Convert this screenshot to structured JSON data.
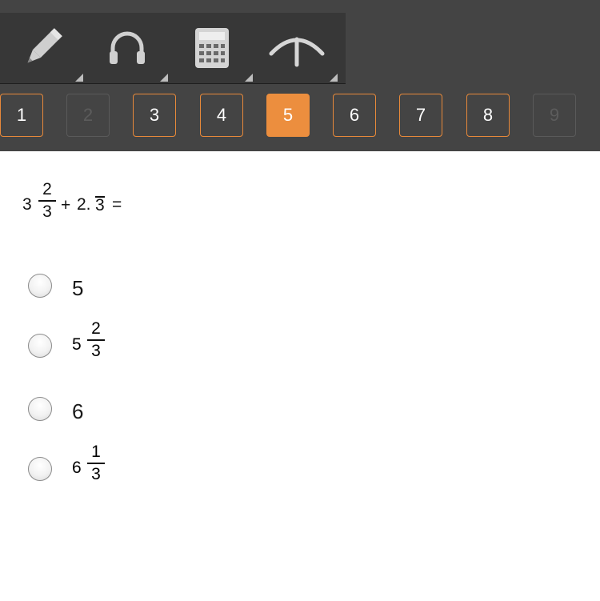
{
  "toolbar": {
    "tools": [
      {
        "name": "pencil-icon"
      },
      {
        "name": "headphones-icon"
      },
      {
        "name": "calculator-icon"
      },
      {
        "name": "compass-icon"
      }
    ]
  },
  "question_nav": {
    "items": [
      {
        "label": "1",
        "state": "answered"
      },
      {
        "label": "2",
        "state": "disabled"
      },
      {
        "label": "3",
        "state": "answered"
      },
      {
        "label": "4",
        "state": "answered"
      },
      {
        "label": "5",
        "state": "active"
      },
      {
        "label": "6",
        "state": "answered"
      },
      {
        "label": "7",
        "state": "answered"
      },
      {
        "label": "8",
        "state": "answered"
      },
      {
        "label": "9",
        "state": "disabled"
      }
    ],
    "accent_color": "#ec8e3e"
  },
  "question": {
    "whole": "3",
    "numerator": "2",
    "denominator": "3",
    "plus": "+",
    "decimal_prefix": "2.",
    "repeating_digit": "3",
    "equals": "="
  },
  "options": [
    {
      "whole": "5"
    },
    {
      "whole": "5",
      "numerator": "2",
      "denominator": "3"
    },
    {
      "whole": "6"
    },
    {
      "whole": "6",
      "numerator": "1",
      "denominator": "3"
    }
  ]
}
